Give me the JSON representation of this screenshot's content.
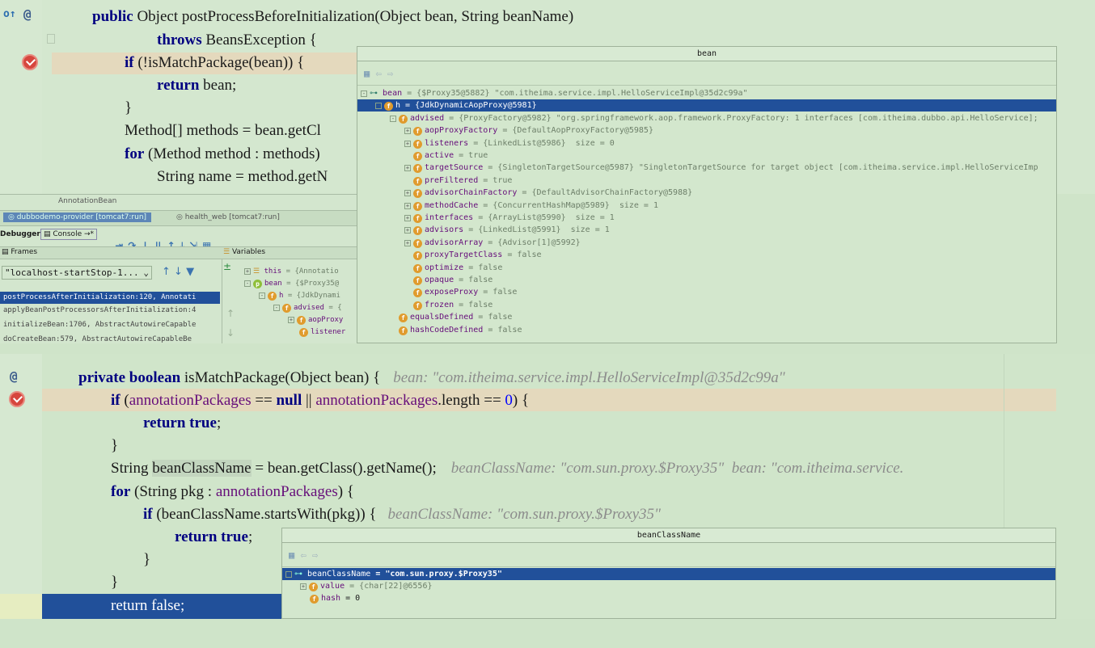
{
  "top_code": {
    "line1": {
      "kw": "public",
      "rest": " Object postProcessBeforeInitialization(Object bean, String beanName)"
    },
    "line2": {
      "kw": "throws",
      "rest": " BeansException {"
    },
    "line3": {
      "kw": "if",
      "rest": " (!isMatchPackage(bean)) {"
    },
    "line4": {
      "kw": "return",
      "rest": " bean;"
    },
    "line5": "}",
    "line6": "Method[] methods = bean.getCl",
    "line7": {
      "kw": "for",
      "rest": " (Method method : methods)"
    },
    "line8": "String name = method.getN"
  },
  "bean_popup": {
    "title": "bean",
    "rows": [
      {
        "name": "bean",
        "value": " = {$Proxy35@5882} \"com.itheima.service.impl.HelloServiceImpl@35d2c99a\""
      },
      {
        "name": "h",
        "value": " = {JdkDynamicAopProxy@5981}"
      },
      {
        "name": "advised",
        "value": " = {ProxyFactory@5982} \"org.springframework.aop.framework.ProxyFactory: 1 interfaces [com.itheima.dubbo.api.HelloService];"
      },
      {
        "name": "aopProxyFactory",
        "value": " = {DefaultAopProxyFactory@5985}"
      },
      {
        "name": "listeners",
        "value": " = {LinkedList@5986}  size = 0"
      },
      {
        "name": "active",
        "value": " = true"
      },
      {
        "name": "targetSource",
        "value": " = {SingletonTargetSource@5987} \"SingletonTargetSource for target object [com.itheima.service.impl.HelloServiceImp"
      },
      {
        "name": "preFiltered",
        "value": " = true"
      },
      {
        "name": "advisorChainFactory",
        "value": " = {DefaultAdvisorChainFactory@5988}"
      },
      {
        "name": "methodCache",
        "value": " = {ConcurrentHashMap@5989}  size = 1"
      },
      {
        "name": "interfaces",
        "value": " = {ArrayList@5990}  size = 1"
      },
      {
        "name": "advisors",
        "value": " = {LinkedList@5991}  size = 1"
      },
      {
        "name": "advisorArray",
        "value": " = {Advisor[1]@5992}"
      },
      {
        "name": "proxyTargetClass",
        "value": " = false"
      },
      {
        "name": "optimize",
        "value": " = false"
      },
      {
        "name": "opaque",
        "value": " = false"
      },
      {
        "name": "exposeProxy",
        "value": " = false"
      },
      {
        "name": "frozen",
        "value": " = false"
      },
      {
        "name": "equalsDefined",
        "value": " = false"
      },
      {
        "name": "hashCodeDefined",
        "value": " = false"
      }
    ]
  },
  "debugger": {
    "breadcrumb": "AnnotationBean",
    "tab1": "dubbodemo-provider [tomcat7:run]",
    "tab2": "health_web [tomcat7:run]",
    "debugger_tab": "Debugger",
    "console_tab": "Console →*",
    "frames_label": "Frames",
    "variables_label": "Variables",
    "thread": "\"localhost-startStop-1...",
    "frames": [
      "postProcessAfterInitialization:120, Annotati",
      "applyBeanPostProcessorsAfterInitialization:4",
      "initializeBean:1706, AbstractAutowireCapable",
      "doCreateBean:579, AbstractAutowireCapableBe"
    ],
    "vars": [
      {
        "name": "this",
        "value": " = {Annotatio"
      },
      {
        "name": "bean",
        "value": " = {$Proxy35@"
      },
      {
        "name": "h",
        "value": " = {JdkDynami"
      },
      {
        "name": "advised",
        "value": " = {"
      },
      {
        "name": "aopProxy",
        "value": ""
      },
      {
        "name": "listener",
        "value": ""
      }
    ]
  },
  "bottom_code": {
    "l1": {
      "kw": "private boolean",
      "rest": " isMatchPackage(Object bean) {",
      "hint": "bean: \"com.itheima.service.impl.HelloServiceImpl@35d2c99a\""
    },
    "l2": {
      "kw": "if",
      "a": " (",
      "f1": "annotationPackages",
      "b": " == ",
      "kw2": "null",
      "c": " || ",
      "f2": "annotationPackages",
      "d": ".length == ",
      "n": "0",
      "e": ") {"
    },
    "l3": {
      "kw": "return true",
      "rest": ";"
    },
    "l4": "}",
    "l5": {
      "a": "String ",
      "var": "beanClassName",
      "b": " = bean.getClass().getName();",
      "hint": "beanClassName: \"com.sun.proxy.$Proxy35\"  bean: \"com.itheima.service."
    },
    "l6": {
      "kw": "for",
      "a": " (String pkg : ",
      "f": "annotationPackages",
      "b": ") {"
    },
    "l7": {
      "kw": "if",
      "rest": " (beanClassName.startsWith(pkg)) {",
      "hint": "beanClassName: \"com.sun.proxy.$Proxy35\""
    },
    "l8": {
      "kw": "return true",
      "rest": ";"
    },
    "l9": "}",
    "l10": "}",
    "l11": {
      "kw": "return false",
      "rest": ";"
    }
  },
  "bcn_popup": {
    "title": "beanClassName",
    "rows": [
      {
        "name": "beanClassName",
        "value": " = \"com.sun.proxy.$Proxy35\""
      },
      {
        "name": "value",
        "value": " = {char[22]@6556}"
      },
      {
        "name": "hash",
        "value": " = 0"
      }
    ]
  }
}
